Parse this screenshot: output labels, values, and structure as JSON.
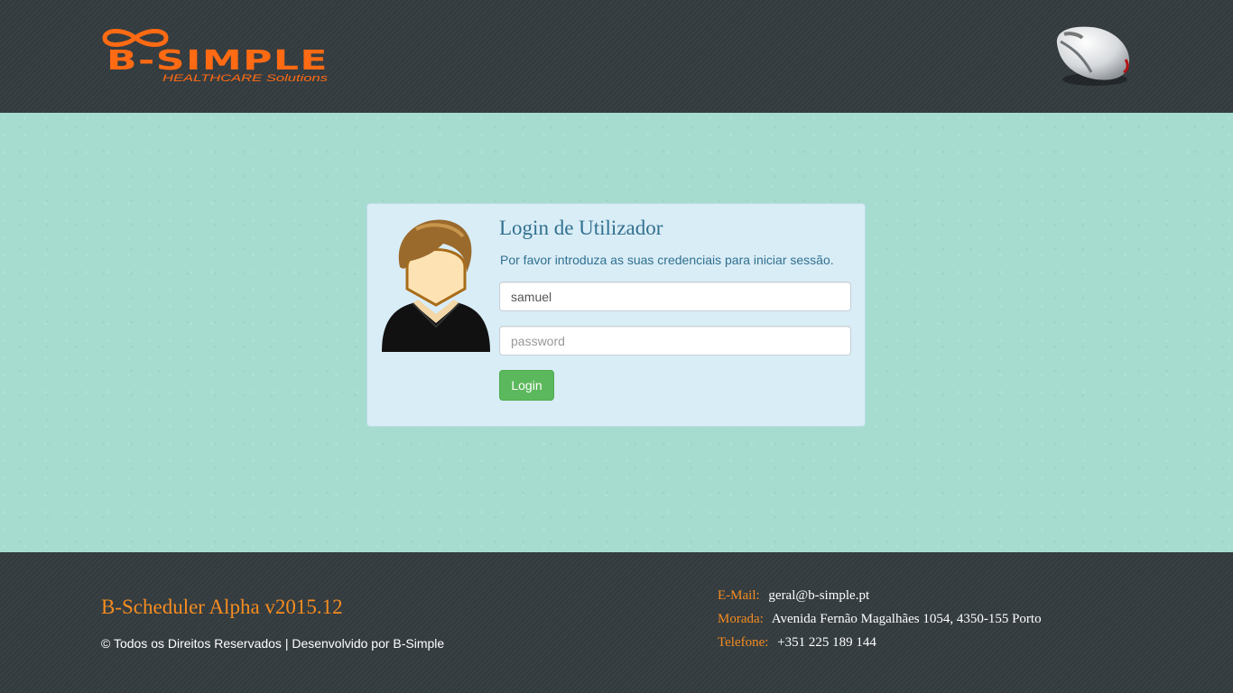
{
  "header": {
    "logo_text": "B-SIMPLE",
    "logo_tagline": "HEALTHCARE Solutions",
    "mouse_icon": "mouse-icon"
  },
  "login": {
    "title": "Login de Utilizador",
    "subtitle": "Por favor introduza as suas credenciais para iniciar sessão.",
    "username_value": "samuel",
    "password_placeholder": "password",
    "button_label": "Login",
    "avatar_icon": "user-avatar-icon"
  },
  "footer": {
    "app_version": "B-Scheduler Alpha v2015.12",
    "copyright": "© Todos os Direitos Reservados | Desenvolvido por B-Simple",
    "email_label": "E-Mail:",
    "email_value": "geral@b-simple.pt",
    "address_label": "Morada:",
    "address_value": "Avenida Fernão Magalhães 1054, 4350-155 Porto",
    "phone_label": "Telefone:",
    "phone_value": "+351 225 189 144"
  },
  "colors": {
    "brand_orange": "#f68c1f",
    "header_bg": "#343c40",
    "page_bg": "#a6dccf",
    "panel_bg": "#d9edf7",
    "panel_text": "#31708f",
    "button_green": "#5cb85c"
  }
}
